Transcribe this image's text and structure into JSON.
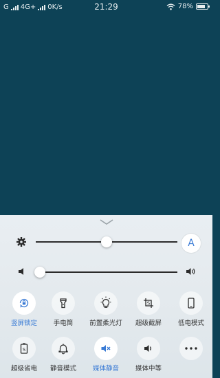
{
  "status_bar": {
    "sim1": "G",
    "sim2": "4G+",
    "speed": "0K/s",
    "time": "21:29",
    "battery_percent": "78%",
    "battery_level": 0.78
  },
  "brightness": {
    "level": 0.5,
    "auto_label": "A"
  },
  "volume": {
    "level": 0.03
  },
  "colors": {
    "accent": "#3a7bd5",
    "wallpaper": "#0d4256",
    "panel": "#e6ebef"
  },
  "tiles": [
    {
      "label": "竖屏锁定",
      "icon": "rotation-lock-icon",
      "active": true
    },
    {
      "label": "手电筒",
      "icon": "flashlight-icon",
      "active": false
    },
    {
      "label": "前置柔光灯",
      "icon": "lightbulb-icon",
      "active": false
    },
    {
      "label": "超级截屏",
      "icon": "screenshot-icon",
      "active": false
    },
    {
      "label": "低电模式",
      "icon": "phone-icon",
      "active": false
    },
    {
      "label": "超级省电",
      "icon": "power-saving-icon",
      "active": false
    },
    {
      "label": "静音模式",
      "icon": "bell-icon",
      "active": false
    },
    {
      "label": "媒体静音",
      "icon": "speaker-mute-icon",
      "active": true
    },
    {
      "label": "媒体中等",
      "icon": "speaker-icon",
      "active": false
    },
    {
      "label": "",
      "icon": "more-icon",
      "active": false
    }
  ]
}
